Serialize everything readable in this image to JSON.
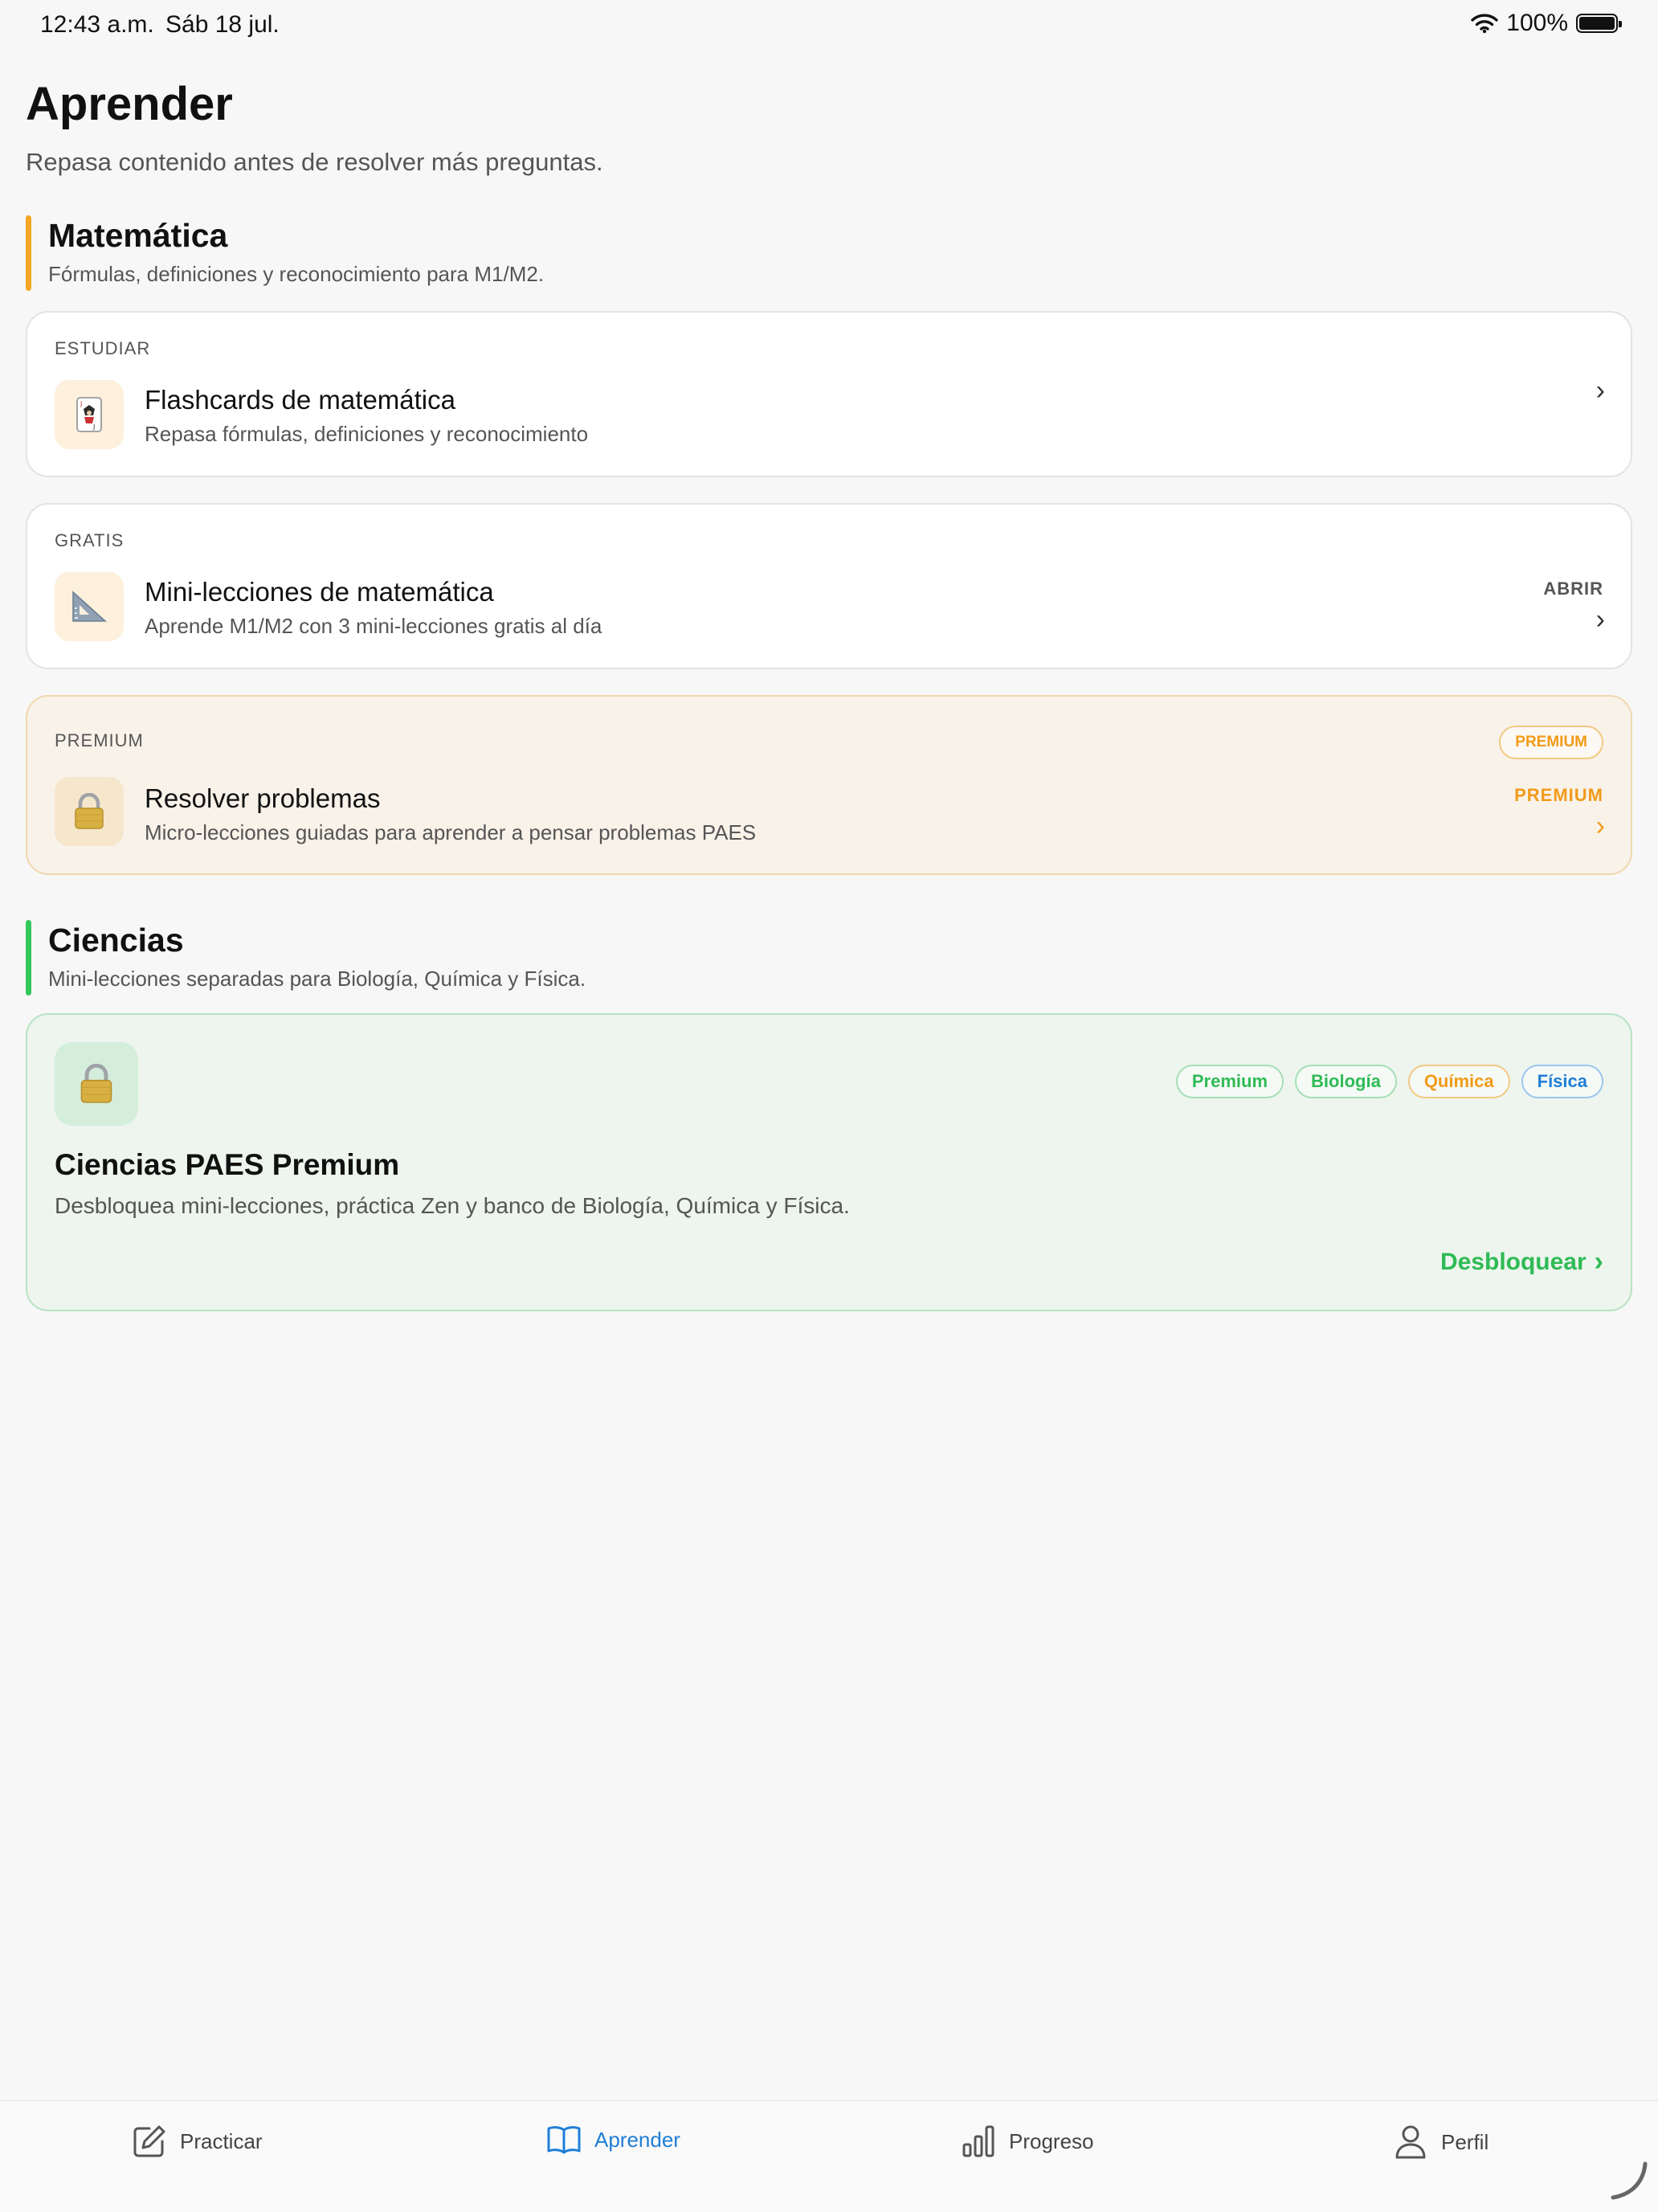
{
  "status": {
    "time": "12:43 a.m.",
    "date": "Sáb 18 jul.",
    "battery": "100%"
  },
  "header": {
    "title": "Aprender",
    "subtitle": "Repasa contenido antes de resolver más preguntas."
  },
  "colors": {
    "math_accent": "#f5a623",
    "science_accent": "#34c759",
    "active_tab": "#1f7ed8",
    "premium_orange": "#f29a18",
    "science_green": "#2fbb55"
  },
  "math": {
    "title": "Matemática",
    "description": "Fórmulas, definiciones y reconocimiento para M1/M2.",
    "cards": [
      {
        "kicker": "ESTUDIAR",
        "icon": "joker-card-icon",
        "title": "Flashcards de matemática",
        "subtitle": "Repasa fórmulas, definiciones y reconocimiento"
      },
      {
        "kicker": "GRATIS",
        "icon": "triangle-ruler-icon",
        "title": "Mini-lecciones de matemática",
        "subtitle": "Aprende M1/M2 con 3 mini-lecciones gratis al día",
        "action": "ABRIR"
      },
      {
        "kicker": "PREMIUM",
        "badge": "PREMIUM",
        "icon": "lock-icon",
        "title": "Resolver problemas",
        "subtitle": "Micro-lecciones guiadas para aprender a pensar problemas PAES",
        "action": "PREMIUM"
      }
    ]
  },
  "science": {
    "title": "Ciencias",
    "description": "Mini-lecciones separadas para Biología, Química y Física.",
    "card": {
      "icon": "lock-icon",
      "tags": [
        "Premium",
        "Biología",
        "Química",
        "Física"
      ],
      "title": "Ciencias PAES Premium",
      "subtitle": "Desbloquea mini-lecciones, práctica Zen y banco de Biología, Química y Física.",
      "cta": "Desbloquear"
    }
  },
  "tabs": [
    {
      "label": "Practicar",
      "icon": "pencil-square-icon"
    },
    {
      "label": "Aprender",
      "icon": "book-icon",
      "active": true
    },
    {
      "label": "Progreso",
      "icon": "bar-chart-icon"
    },
    {
      "label": "Perfil",
      "icon": "person-icon"
    }
  ]
}
